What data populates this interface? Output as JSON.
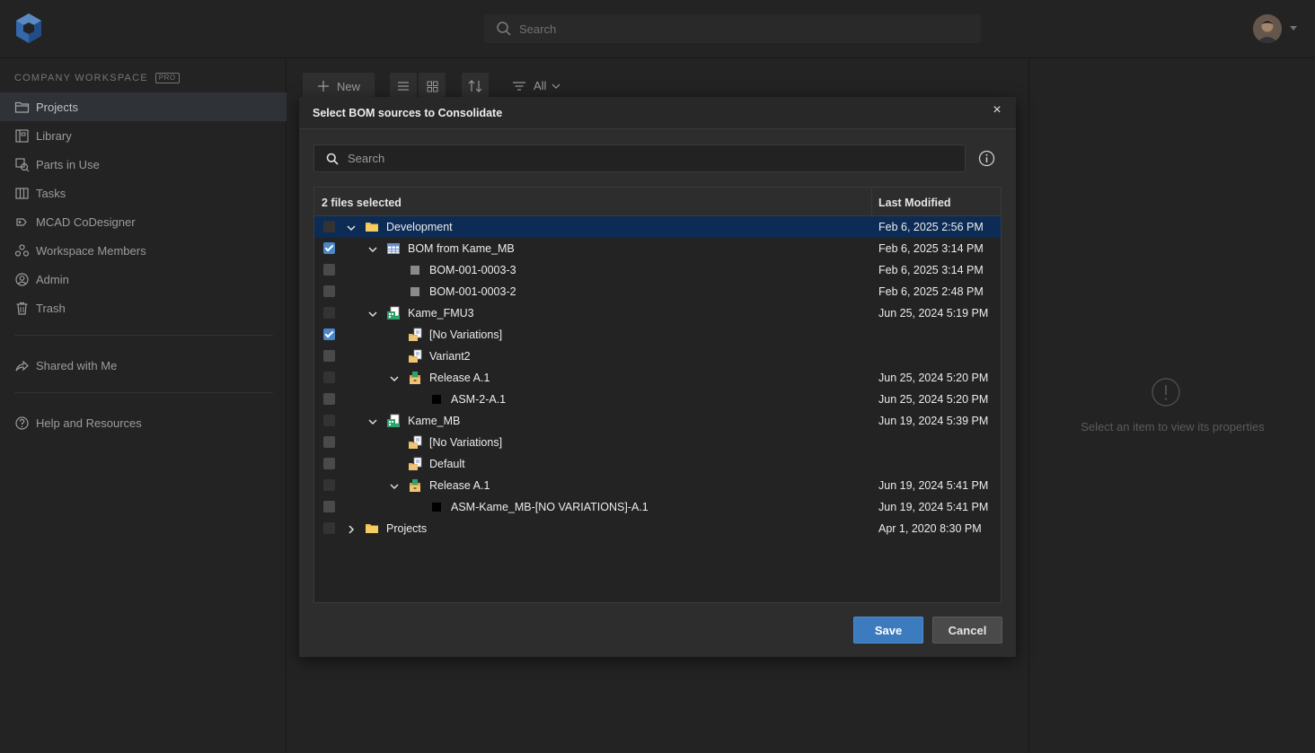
{
  "topbar": {
    "search_placeholder": "Search"
  },
  "sidebar": {
    "workspace_label": "COMPANY WORKSPACE",
    "badge": "PRO",
    "items": [
      {
        "label": "Projects",
        "icon": "folder-icon",
        "active": true
      },
      {
        "label": "Library",
        "icon": "library-icon"
      },
      {
        "label": "Parts in Use",
        "icon": "parts-in-use-icon"
      },
      {
        "label": "Tasks",
        "icon": "tasks-icon"
      },
      {
        "label": "MCAD CoDesigner",
        "icon": "codesigner-icon"
      },
      {
        "label": "Workspace Members",
        "icon": "members-icon"
      },
      {
        "label": "Admin",
        "icon": "admin-icon"
      },
      {
        "label": "Trash",
        "icon": "trash-icon"
      }
    ],
    "shared": {
      "label": "Shared with Me",
      "icon": "share-icon"
    },
    "help": {
      "label": "Help and Resources",
      "icon": "help-icon"
    }
  },
  "toolbar": {
    "new_label": "New",
    "filter_label": "All"
  },
  "properties": {
    "empty_text": "Select an item to view its properties"
  },
  "modal": {
    "title": "Select BOM sources to Consolidate",
    "close": "×",
    "search_placeholder": "Search",
    "header_selected": "2 files selected",
    "header_modified": "Last Modified",
    "save_label": "Save",
    "cancel_label": "Cancel",
    "rows": [
      {
        "name": "Development",
        "date": "Feb 6, 2025 2:56 PM",
        "level": 0,
        "icon": "folder-icon",
        "expander": "down",
        "checkbox": "dim",
        "selected": true
      },
      {
        "name": "BOM from Kame_MB",
        "date": "Feb 6, 2025 3:14 PM",
        "level": 1,
        "icon": "bom-table-icon",
        "expander": "down",
        "checkbox": "checked"
      },
      {
        "name": "BOM-001-0003-3",
        "date": "Feb 6, 2025 3:14 PM",
        "level": 2,
        "icon": "gray-square-icon",
        "expander": "none",
        "checkbox": "normal"
      },
      {
        "name": "BOM-001-0003-2",
        "date": "Feb 6, 2025 2:48 PM",
        "level": 2,
        "icon": "gray-square-icon",
        "expander": "none",
        "checkbox": "normal"
      },
      {
        "name": "Kame_FMU3",
        "date": "Jun 25, 2024 5:19 PM",
        "level": 1,
        "icon": "assembly-icon",
        "expander": "down",
        "checkbox": "dim"
      },
      {
        "name": "[No Variations]",
        "date": "",
        "level": 2,
        "icon": "variation-icon",
        "expander": "none",
        "checkbox": "checked"
      },
      {
        "name": "Variant2",
        "date": "",
        "level": 2,
        "icon": "variation-icon",
        "expander": "none",
        "checkbox": "normal"
      },
      {
        "name": "Release A.1",
        "date": "Jun 25, 2024 5:20 PM",
        "level": 2,
        "icon": "release-icon",
        "expander": "down",
        "checkbox": "dim"
      },
      {
        "name": "ASM-2-A.1",
        "date": "Jun 25, 2024 5:20 PM",
        "level": 3,
        "icon": "black-square-icon",
        "expander": "none",
        "checkbox": "normal"
      },
      {
        "name": "Kame_MB",
        "date": "Jun 19, 2024 5:39 PM",
        "level": 1,
        "icon": "assembly-icon",
        "expander": "down",
        "checkbox": "dim"
      },
      {
        "name": "[No Variations]",
        "date": "",
        "level": 2,
        "icon": "variation-icon",
        "expander": "none",
        "checkbox": "normal"
      },
      {
        "name": "Default",
        "date": "",
        "level": 2,
        "icon": "variation-icon",
        "expander": "none",
        "checkbox": "normal"
      },
      {
        "name": "Release A.1",
        "date": "Jun 19, 2024 5:41 PM",
        "level": 2,
        "icon": "release-icon",
        "expander": "down",
        "checkbox": "dim"
      },
      {
        "name": "ASM-Kame_MB-[NO VARIATIONS]-A.1",
        "date": "Jun 19, 2024 5:41 PM",
        "level": 3,
        "icon": "black-square-icon",
        "expander": "none",
        "checkbox": "normal"
      },
      {
        "name": "Projects",
        "date": "Apr 1, 2020 8:30 PM",
        "level": 0,
        "icon": "folder-icon",
        "expander": "right",
        "checkbox": "dim"
      }
    ]
  },
  "colors": {
    "accent": "#3d7bbf",
    "selected_row": "#0c2b55",
    "folder": "#f2c14e",
    "assembly": "#2fa36b"
  }
}
